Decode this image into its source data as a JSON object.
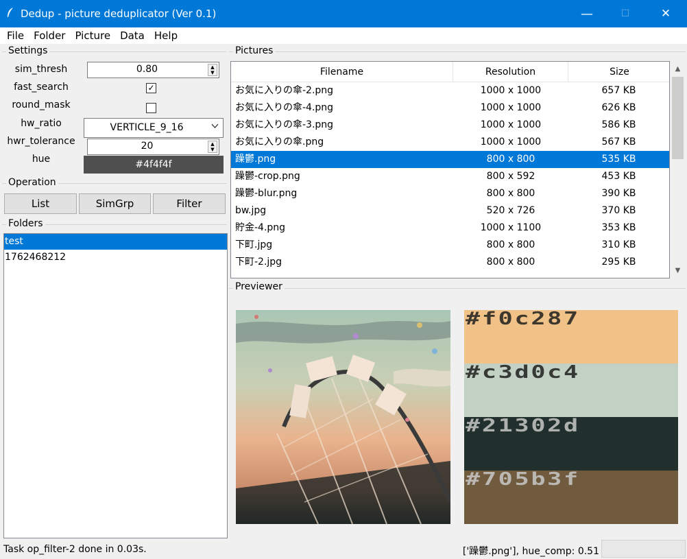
{
  "window": {
    "title": "Dedup - picture deduplicator (Ver 0.1)",
    "minimize": "—",
    "maximize": "☐",
    "close": "✕"
  },
  "menu": [
    "File",
    "Folder",
    "Picture",
    "Data",
    "Help"
  ],
  "settings": {
    "group_label": "Settings",
    "sim_thresh": {
      "label": "sim_thresh",
      "value": "0.80"
    },
    "fast_search": {
      "label": "fast_search",
      "checked": true
    },
    "round_mask": {
      "label": "round_mask",
      "checked": false
    },
    "hw_ratio": {
      "label": "hw_ratio",
      "value": "VERTICLE_9_16"
    },
    "hwr_tolerance": {
      "label": "hwr_tolerance",
      "value": "20"
    },
    "hue": {
      "label": "hue",
      "value": "#4f4f4f"
    }
  },
  "operation": {
    "group_label": "Operation",
    "buttons": [
      "List",
      "SimGrp",
      "Filter"
    ]
  },
  "folders": {
    "group_label": "Folders",
    "items": [
      {
        "name": "test",
        "selected": true
      },
      {
        "name": "1762468212",
        "selected": false
      }
    ]
  },
  "pictures": {
    "group_label": "Pictures",
    "columns": [
      "Filename",
      "Resolution",
      "Size"
    ],
    "rows": [
      {
        "filename": "お気に入りの傘-2.png",
        "resolution": "1000 x 1000",
        "size": "657 KB"
      },
      {
        "filename": "お気に入りの傘-4.png",
        "resolution": "1000 x 1000",
        "size": "626 KB"
      },
      {
        "filename": "お気に入りの傘-3.png",
        "resolution": "1000 x 1000",
        "size": "586 KB"
      },
      {
        "filename": "お気に入りの傘.png",
        "resolution": "1000 x 1000",
        "size": "567 KB"
      },
      {
        "filename": "躁鬱.png",
        "resolution": "800 x 800",
        "size": "535 KB",
        "selected": true
      },
      {
        "filename": "躁鬱-crop.png",
        "resolution": "800 x 592",
        "size": "453 KB"
      },
      {
        "filename": "躁鬱-blur.png",
        "resolution": "800 x 800",
        "size": "390 KB"
      },
      {
        "filename": "bw.jpg",
        "resolution": "520 x 726",
        "size": "370 KB"
      },
      {
        "filename": "貯金-4.png",
        "resolution": "1000 x 1100",
        "size": "353 KB"
      },
      {
        "filename": "下町.jpg",
        "resolution": "800 x 800",
        "size": "310 KB"
      },
      {
        "filename": "下町-2.jpg",
        "resolution": "800 x 800",
        "size": "295 KB"
      }
    ]
  },
  "previewer": {
    "group_label": "Previewer",
    "palette": [
      {
        "label": "#f0c287",
        "color": "#f0c287"
      },
      {
        "label": "#c3d0c4",
        "color": "#c3d0c4"
      },
      {
        "label": "#21302d",
        "color": "#21302d"
      },
      {
        "label": "#705b3f",
        "color": "#705b3f"
      }
    ]
  },
  "status": {
    "left": "Task op_filter-2 done in 0.03s.",
    "right": "['躁鬱.png'], hue_comp: 0.51"
  }
}
